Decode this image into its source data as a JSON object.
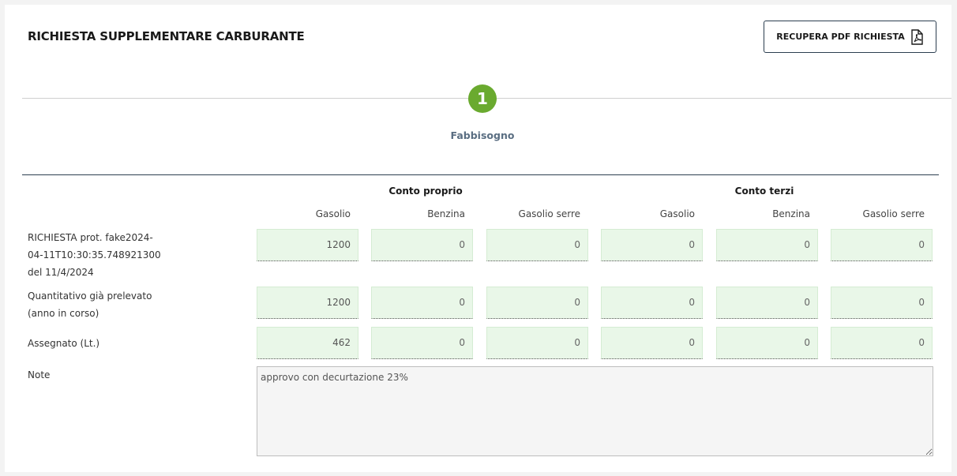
{
  "header": {
    "title": "RICHIESTA SUPPLEMENTARE CARBURANTE",
    "pdf_button_label": "RECUPERA PDF RICHIESTA"
  },
  "stepper": {
    "steps": [
      {
        "number": "1",
        "label": "Fabbisogno"
      }
    ],
    "active_color": "#6aaa2f"
  },
  "table": {
    "groups": [
      "Conto proprio",
      "Conto terzi"
    ],
    "columns": [
      "Gasolio",
      "Benzina",
      "Gasolio serre",
      "Gasolio",
      "Benzina",
      "Gasolio serre"
    ],
    "rows": [
      {
        "label_lines": [
          "RICHIESTA prot. fake2024-",
          "04-11T10:30:35.748921300",
          "del 11/4/2024"
        ],
        "values": [
          "1200",
          "0",
          "0",
          "0",
          "0",
          "0"
        ]
      },
      {
        "label_lines": [
          "Quantitativo già prelevato",
          "(anno in corso)"
        ],
        "values": [
          "1200",
          "0",
          "0",
          "0",
          "0",
          "0"
        ]
      },
      {
        "label_lines": [
          "Assegnato (Lt.)"
        ],
        "values": [
          "462",
          "0",
          "0",
          "0",
          "0",
          "0"
        ]
      }
    ]
  },
  "note": {
    "label": "Note",
    "value": "approvo con decurtazione 23%"
  },
  "icons": {
    "pdf_button_icon": "pdf-file-icon"
  }
}
